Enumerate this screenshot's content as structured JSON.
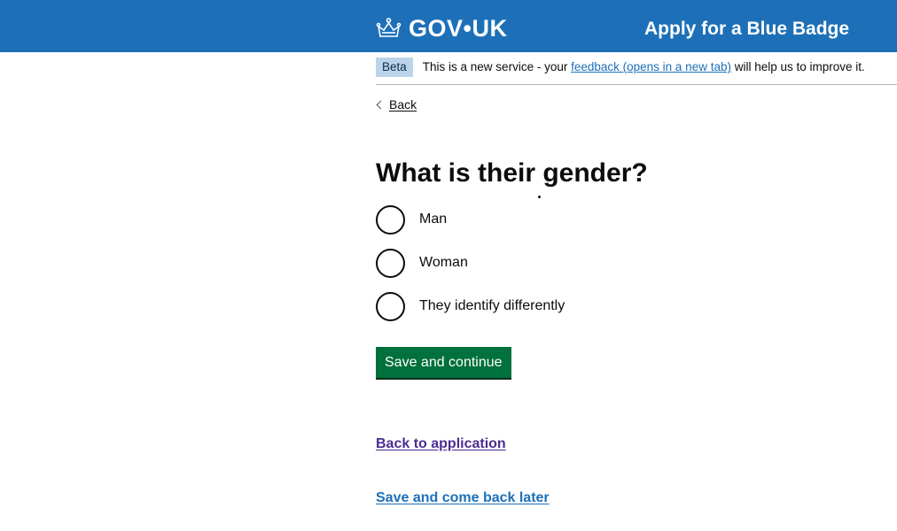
{
  "header": {
    "logo_text": "GOV•UK",
    "logo_icon": "crown-icon",
    "service_name": "Apply for a Blue Badge",
    "background_color": "#1d70b8"
  },
  "phase_banner": {
    "tag": "Beta",
    "text_before": "This is a new service - your ",
    "link_text": "feedback (opens in a new tab)",
    "text_after": " will help us to improve it."
  },
  "back_link": {
    "icon": "chevron-left-icon",
    "label": "Back"
  },
  "question": {
    "title": "What is their gender?",
    "options": [
      {
        "label": "Man",
        "selected": false
      },
      {
        "label": "Woman",
        "selected": false
      },
      {
        "label": "They identify differently",
        "selected": false
      }
    ]
  },
  "actions": {
    "save_continue_label": "Save and continue",
    "save_continue_color": "#00703c",
    "back_to_application": "Back to application",
    "save_come_back_later": "Save and come back later"
  }
}
